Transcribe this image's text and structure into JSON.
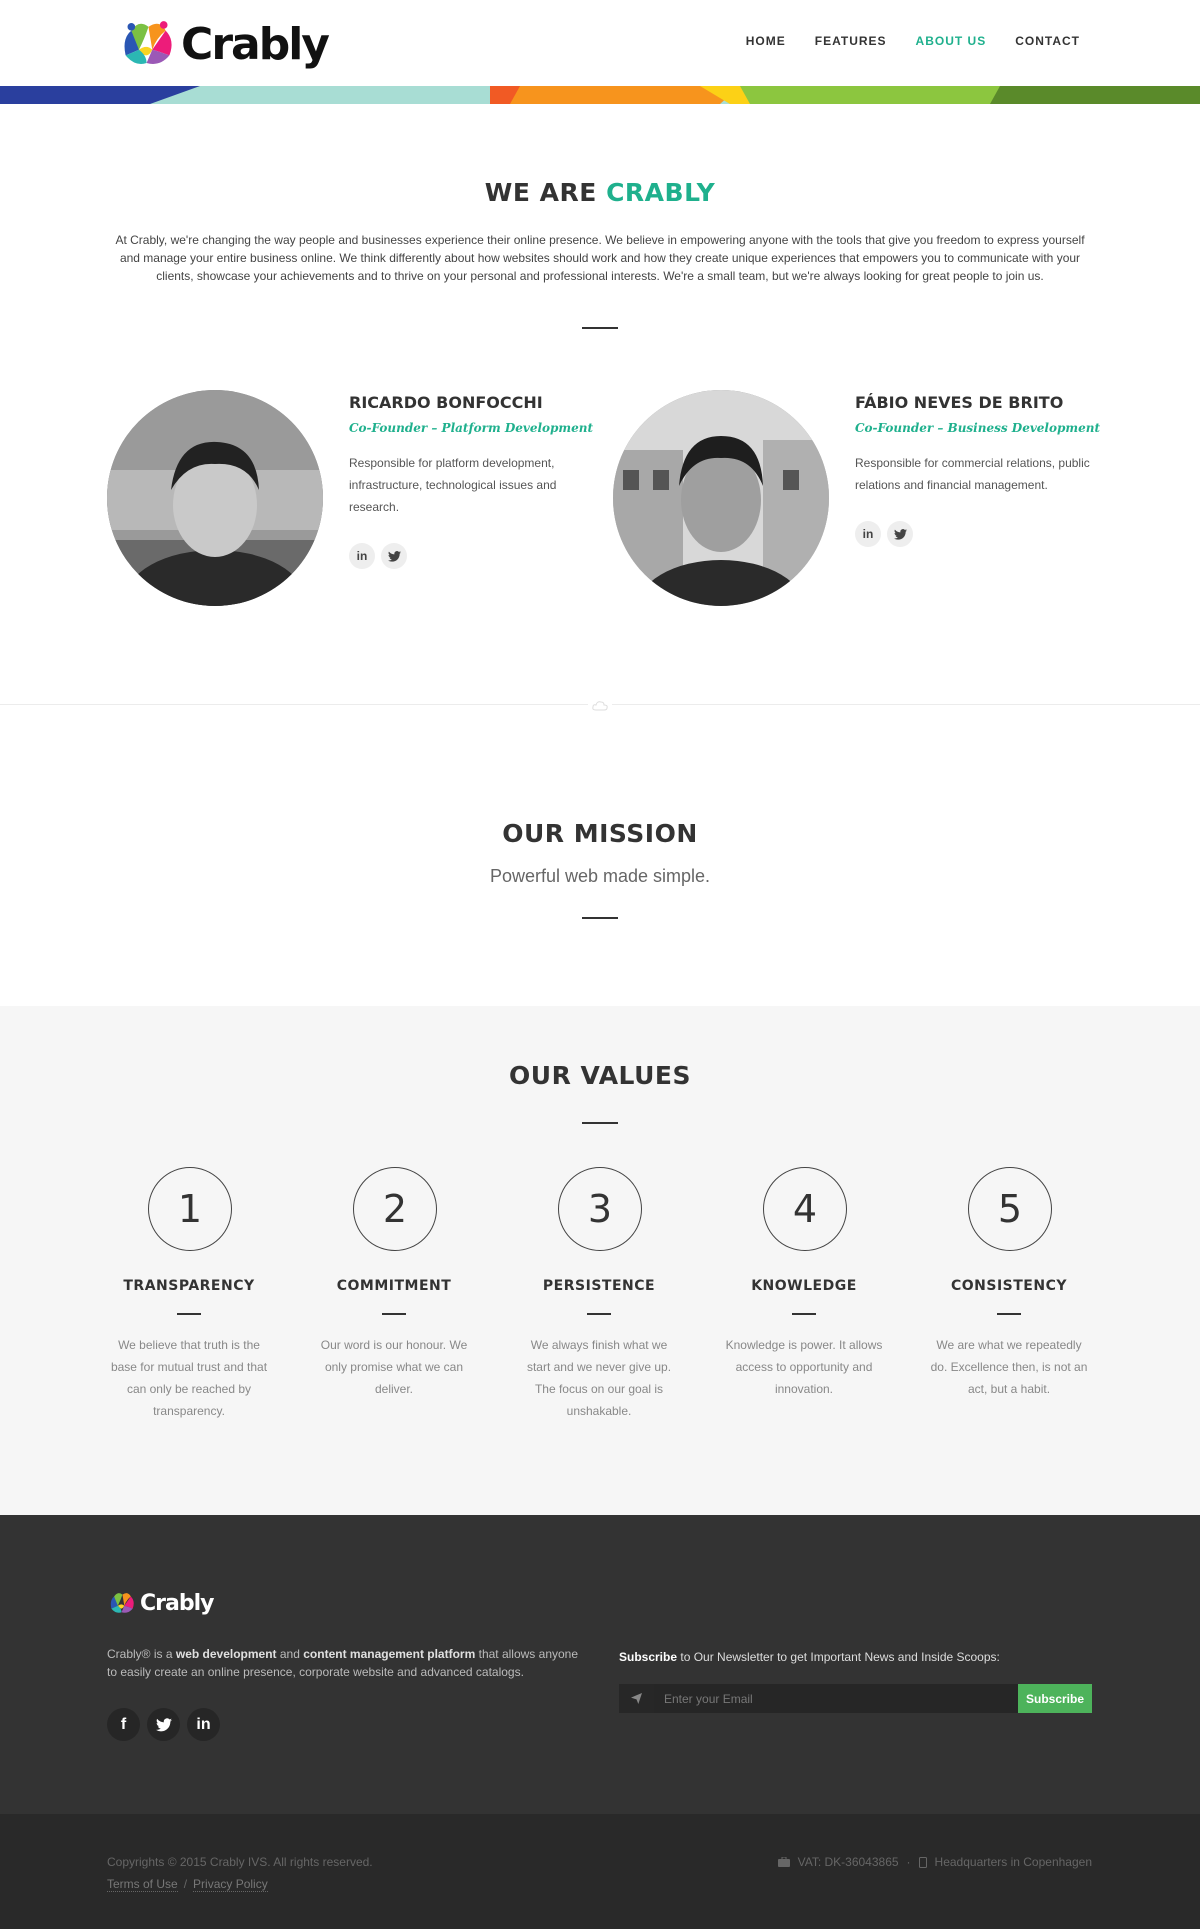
{
  "brand": {
    "name": "Crably",
    "accent": "#1fb08d"
  },
  "nav": {
    "items": [
      {
        "label": "HOME"
      },
      {
        "label": "FEATURES"
      },
      {
        "label": "ABOUT US",
        "active": true
      },
      {
        "label": "CONTACT"
      }
    ]
  },
  "about": {
    "title_prefix": "WE ARE",
    "title_accent": "CRABLY",
    "intro": "At Crably, we're changing the way people and businesses experience their online presence. We believe in empowering anyone with the tools that give you freedom to express yourself and manage your entire business online. We think differently about how websites should work and how they create unique experiences that empowers you to communicate with your clients, showcase your achievements and to thrive on your personal and professional interests. We're a small team, but we're always looking for great people to join us."
  },
  "team": [
    {
      "name": "RICARDO BONFOCCHI",
      "role": "Co-Founder – Platform Development",
      "description": "Responsible for platform development, infrastructure, technological issues and research.",
      "social": [
        "linkedin-icon",
        "twitter-icon"
      ]
    },
    {
      "name": "FÁBIO NEVES DE BRITO",
      "role": "Co-Founder – Business Development",
      "description": "Responsible for commercial relations, public relations and financial management.",
      "social": [
        "linkedin-icon",
        "twitter-icon"
      ]
    }
  ],
  "mission": {
    "title": "OUR MISSION",
    "subtitle": "Powerful web made simple."
  },
  "values": {
    "title": "OUR VALUES",
    "items": [
      {
        "number": "1",
        "title": "TRANSPARENCY",
        "description": "We believe that truth is the base for mutual trust and that can only be reached by transparency."
      },
      {
        "number": "2",
        "title": "COMMITMENT",
        "description": "Our word is our honour. We only promise what we can deliver."
      },
      {
        "number": "3",
        "title": "PERSISTENCE",
        "description": "We always finish what we start and we never give up. The focus on our goal is unshakable."
      },
      {
        "number": "4",
        "title": "KNOWLEDGE",
        "description": "Knowledge is power. It allows access to opportunity and innovation."
      },
      {
        "number": "5",
        "title": "CONSISTENCY",
        "description": "We are what we repeatedly do. Excellence then, is not an act, but a habit."
      }
    ]
  },
  "footer": {
    "logo_text": "Crably",
    "about_p1": "Crably® is a ",
    "about_b1": "web development",
    "about_p2": " and ",
    "about_b2": "content management platform",
    "about_p3": " that allows anyone to easily create an online presence, corporate website and advanced catalogs.",
    "social": [
      "facebook-icon",
      "twitter-icon",
      "linkedin-icon"
    ],
    "subscribe_bold": "Subscribe",
    "subscribe_text": " to Our Newsletter to get Important News and Inside Scoops:",
    "email_placeholder": "Enter your Email",
    "subscribe_button": "Subscribe",
    "subscribe_color": "#4db35b"
  },
  "bottom": {
    "copyright": "Copyrights © 2015 Crably IVS. All rights reserved.",
    "terms": "Terms of Use",
    "separator": "/",
    "privacy": "Privacy Policy",
    "vat": "VAT: DK-36043865",
    "dot": "·",
    "hq": "Headquarters in Copenhagen"
  }
}
